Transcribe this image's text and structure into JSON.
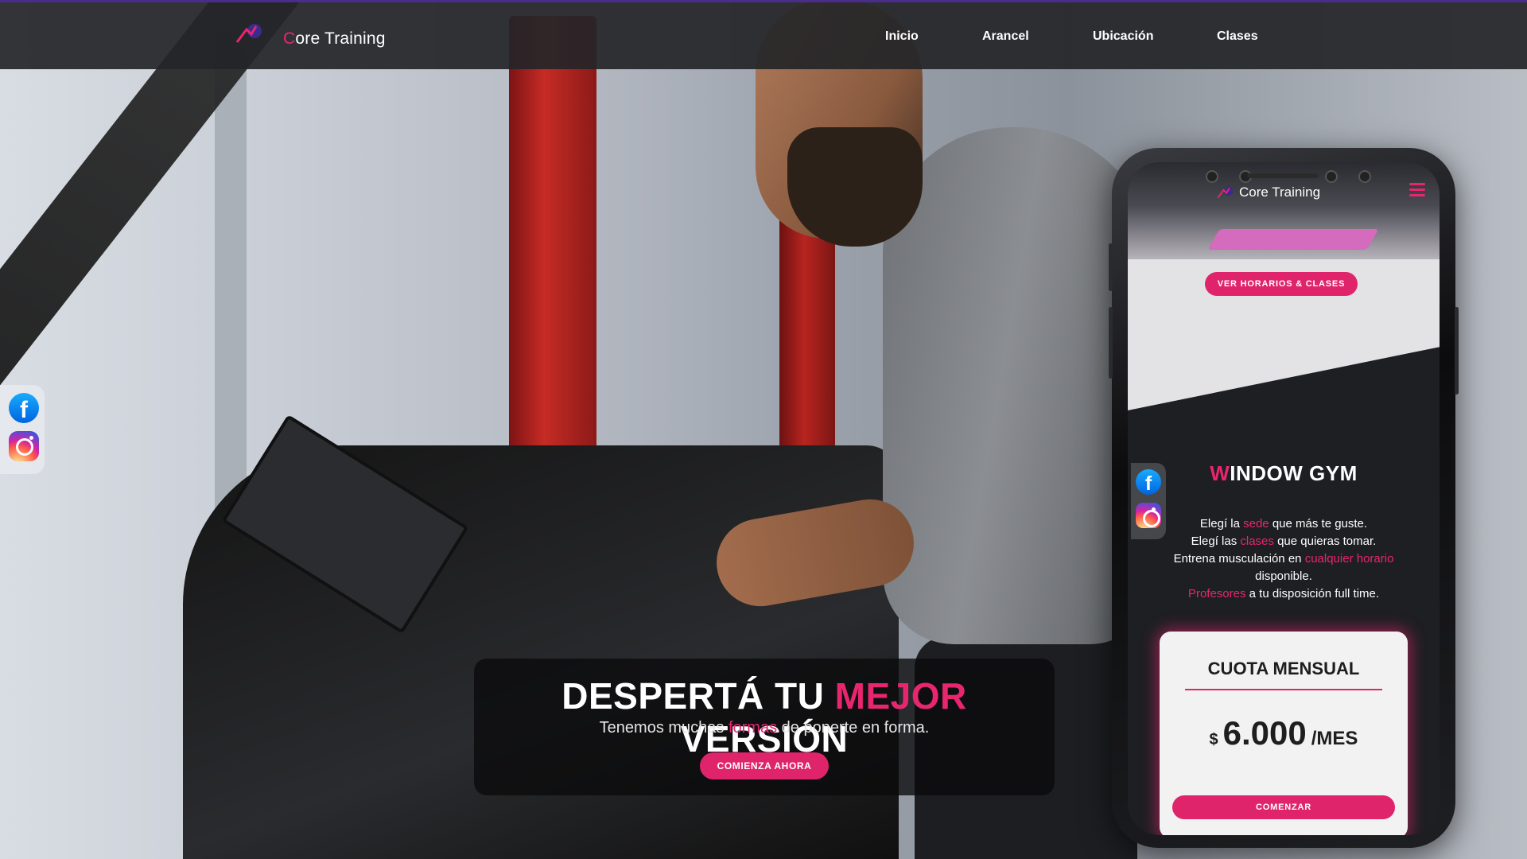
{
  "nav": {
    "brand_first": "C",
    "brand_rest": "ore Training",
    "links": [
      "Inicio",
      "Arancel",
      "Ubicación",
      "Clases"
    ]
  },
  "social": {
    "facebook_icon": "facebook-icon",
    "instagram_icon": "instagram-icon"
  },
  "hero": {
    "title_part1": "DESPERTÁ TU ",
    "title_highlight": "MEJOR",
    "title_part2": " VERSIÓN",
    "subtitle_part1": "Tenemos muchas ",
    "subtitle_highlight": "formas",
    "subtitle_part2": " de ponerte en forma.",
    "cta": "COMIENZA AHORA"
  },
  "mobile": {
    "brand": "Core Training",
    "schedule_button": "VER HORARIOS & CLASES",
    "gym_title_first": "W",
    "gym_title_rest": "INDOW GYM",
    "lines": [
      {
        "a": "Elegí la ",
        "pink": "sede",
        "b": " que más te guste."
      },
      {
        "a": "Elegí las ",
        "pink": "clases",
        "b": " que quieras tomar."
      },
      {
        "a": "Entrena musculación en ",
        "pink": "cualquier horario",
        "b": ""
      },
      {
        "a": "disponible.",
        "pink": "",
        "b": ""
      },
      {
        "a": "",
        "pink": "Profesores",
        "b": " a tu disposición full time."
      }
    ],
    "price_title": "CUOTA MENSUAL",
    "currency": "$",
    "price": "6.000",
    "period": "/MES",
    "price_button": "COMENZAR"
  },
  "colors": {
    "accent": "#e8266f",
    "nav_bg": "#242528"
  }
}
